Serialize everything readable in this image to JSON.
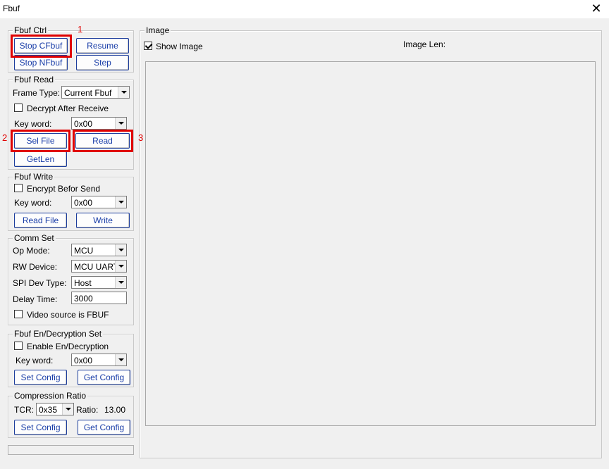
{
  "window": {
    "title": "Fbuf",
    "close_glyph": "✕"
  },
  "fbuf_ctrl": {
    "legend": "Fbuf Ctrl",
    "stop_cfbuf": "Stop CFbuf",
    "resume": "Resume",
    "stop_nfbuf": "Stop NFbuf",
    "step": "Step"
  },
  "fbuf_read": {
    "legend": "Fbuf Read",
    "frame_type_label": "Frame Type:",
    "frame_type_value": "Current Fbuf",
    "decrypt_label": "Decrypt After Receive",
    "keyword_label": "Key word:",
    "keyword_value": "0x00",
    "sel_file": "Sel File",
    "read": "Read",
    "getlen": "GetLen"
  },
  "fbuf_write": {
    "legend": "Fbuf Write",
    "encrypt_label": "Encrypt Befor Send",
    "keyword_label": "Key word:",
    "keyword_value": "0x00",
    "read_file": "Read File",
    "write": "Write"
  },
  "comm_set": {
    "legend": "Comm Set",
    "op_mode_label": "Op Mode:",
    "op_mode_value": "MCU",
    "rw_device_label": "RW Device:",
    "rw_device_value": "MCU UART",
    "spi_dev_label": "SPI Dev Type:",
    "spi_dev_value": "Host",
    "delay_label": "Delay Time:",
    "delay_value": "3000",
    "video_source_label": "Video source is FBUF"
  },
  "endecrypt": {
    "legend": "Fbuf En/Decryption Set",
    "enable_label": "Enable En/Decryption",
    "keyword_label": "Key word:",
    "keyword_value": "0x00",
    "set_config": "Set Config",
    "get_config": "Get Config"
  },
  "compression": {
    "legend": "Compression Ratio",
    "tcr_label": "TCR:",
    "tcr_value": "0x35",
    "ratio_label": "Ratio:",
    "ratio_value": "13.00",
    "set_config": "Set Config",
    "get_config": "Get Config"
  },
  "image": {
    "legend": "Image",
    "show_image_label": "Show Image",
    "show_image_checked": true,
    "image_len_label": "Image Len:"
  },
  "annotations": {
    "one": "1",
    "two": "2",
    "three": "3",
    "color": "#e00000"
  }
}
